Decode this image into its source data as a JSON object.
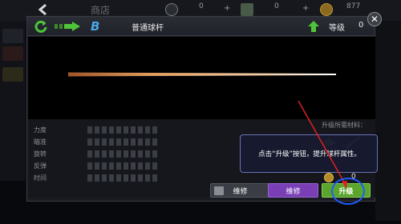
{
  "topbar": {
    "title": "商店",
    "resources": [
      {
        "icon": "coupon-icon",
        "value": "0"
      },
      {
        "icon": "cash-icon",
        "value": "0"
      },
      {
        "icon": "gold-coin-icon",
        "value": "877"
      }
    ]
  },
  "dialog": {
    "cue_name": "普通球杆",
    "level_label": "等级",
    "level_value": "0",
    "stats": [
      {
        "label": "力度",
        "filled": 0
      },
      {
        "label": "瞄准",
        "filled": 0
      },
      {
        "label": "旋转",
        "filled": 0
      },
      {
        "label": "反弹",
        "filled": 0
      },
      {
        "label": "时间",
        "filled": 0
      }
    ],
    "materials_label": "升级所需材料：",
    "upgrade_cost": "0",
    "buttons": {
      "repair1": "维修",
      "repair2": "维修",
      "upgrade": "升级"
    }
  },
  "tooltip": {
    "text": "点击“升级”按钮，提升球杆属性。"
  },
  "colors": {
    "accent_green": "#5ba52d",
    "accent_purple": "#7a3fb5",
    "highlight_blue": "#1f5bff",
    "pointer_red": "#e02020"
  }
}
